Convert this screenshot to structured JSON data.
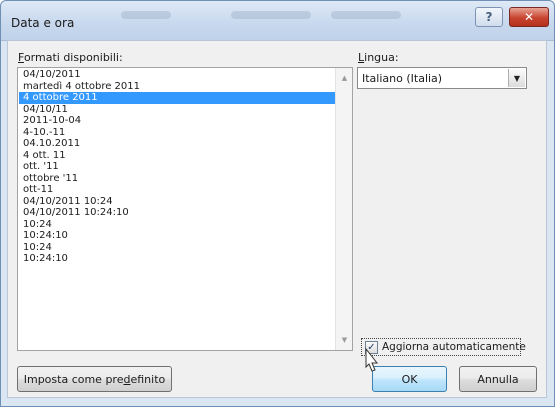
{
  "window": {
    "title": "Data e ora",
    "help_glyph": "?",
    "close_glyph": "✕"
  },
  "formats": {
    "label": "Formati disponibili:",
    "label_access_key": "F",
    "label_rest": "ormati disponibili:",
    "selected_index": 2,
    "items": [
      "04/10/2011",
      "martedì 4 ottobre 2011",
      "4 ottobre 2011",
      "04/10/11",
      "2011-10-04",
      "4-10.-11",
      "04.10.2011",
      "4 ott. 11",
      "ott. '11",
      "ottobre '11",
      "ott-11",
      "04/10/2011 10:24",
      "04/10/2011 10:24:10",
      "10:24",
      "10:24:10",
      "10:24",
      "10:24:10"
    ],
    "scroll_up_icon": "▲",
    "scroll_down_icon": "▼"
  },
  "language": {
    "label": "Lingua:",
    "label_access_key": "L",
    "label_rest": "ingua:",
    "value": "Italiano (Italia)",
    "dropdown_icon": "▼"
  },
  "auto_update": {
    "label": "Aggiorna automaticamente",
    "checked": true,
    "check_glyph": "✓"
  },
  "buttons": {
    "set_default_pre": "Imposta come pre",
    "set_default_key": "d",
    "set_default_post": "efinito",
    "set_default": "Imposta come predefinito",
    "ok": "OK",
    "cancel": "Annulla"
  },
  "colors": {
    "selection": "#3399ff",
    "title_bar": "#c9d9ee",
    "close_button": "#c8442f",
    "dialog_body": "#f0f0f0"
  }
}
